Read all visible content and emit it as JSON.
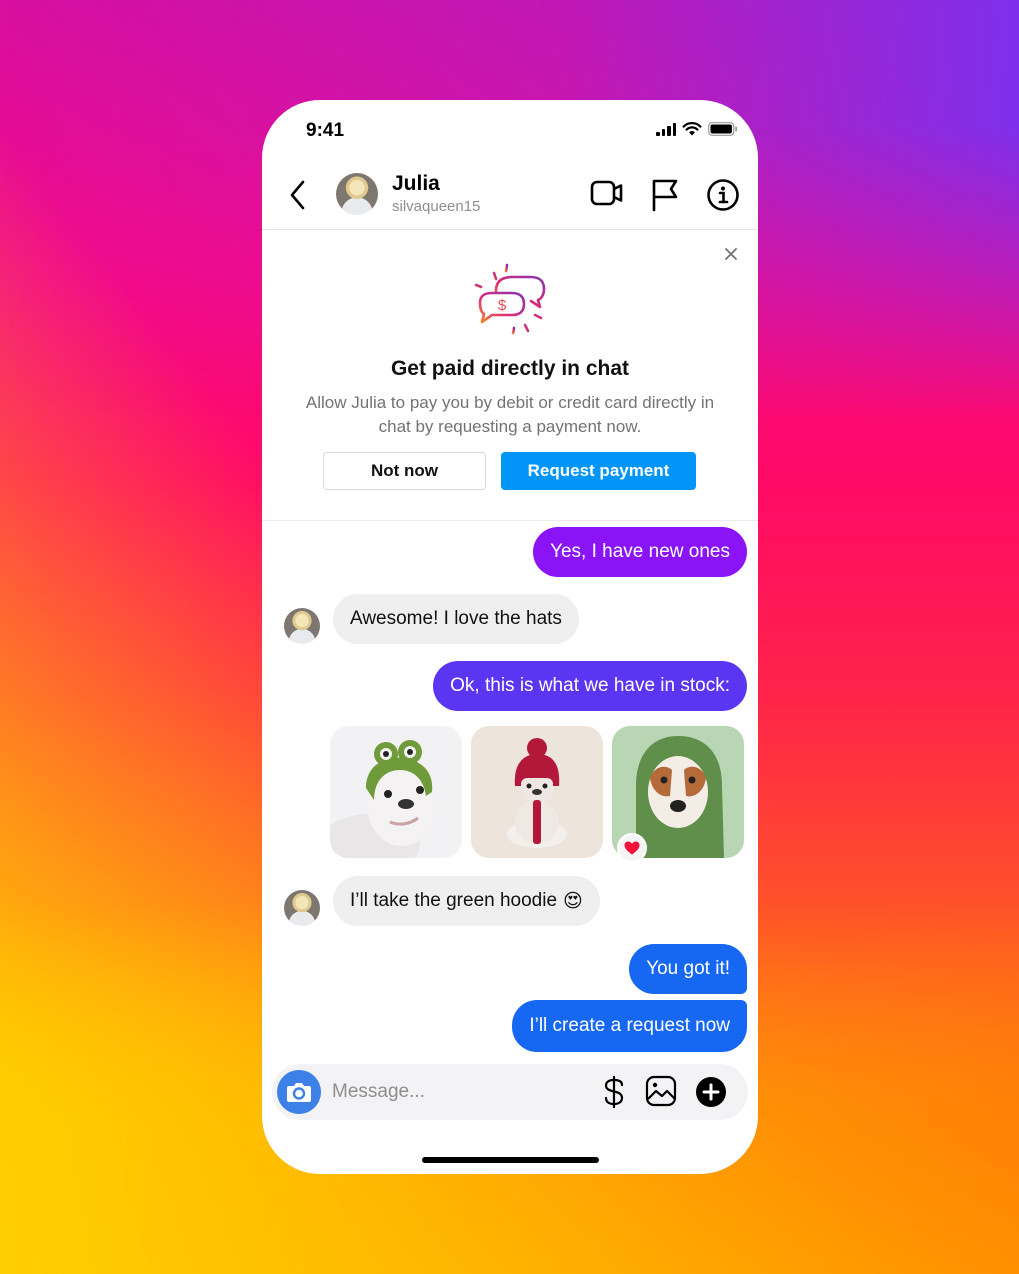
{
  "status_bar": {
    "time": "9:41",
    "icons": [
      "cellular-signal-icon",
      "wifi-icon",
      "battery-icon"
    ]
  },
  "header": {
    "back_icon": "chevron-left-icon",
    "contact_name": "Julia",
    "contact_handle": "silvaqueen15",
    "actions": [
      {
        "name": "video-call",
        "icon": "video-camera-icon"
      },
      {
        "name": "report",
        "icon": "flag-icon"
      },
      {
        "name": "info",
        "icon": "info-icon"
      }
    ]
  },
  "banner": {
    "icon": "payment-chat-bubbles-icon",
    "title": "Get paid directly in chat",
    "description": "Allow Julia to pay you by debit or credit card directly in chat by requesting a payment now.",
    "secondary_button": "Not now",
    "primary_button": "Request payment",
    "close_icon": "close-icon"
  },
  "messages": [
    {
      "direction": "outgoing",
      "text": "Yes, I have new ones",
      "color": "#8a14f6"
    },
    {
      "direction": "incoming",
      "text": "Awesome! I love the hats"
    },
    {
      "direction": "outgoing",
      "text": "Ok, this is what we have in stock:",
      "color": "#5b36f2"
    },
    {
      "direction": "outgoing",
      "type": "photos",
      "photos": [
        {
          "subject": "bulldog in green frog hat"
        },
        {
          "subject": "bulldog in red pom-pom beanie"
        },
        {
          "subject": "beagle in green knit hoodie",
          "reaction": "❤️"
        }
      ]
    },
    {
      "direction": "incoming",
      "text": "I’ll take the green hoodie",
      "emoji": "😍"
    },
    {
      "direction": "outgoing",
      "text": "You got it!",
      "color": "#1668f2"
    },
    {
      "direction": "outgoing",
      "text": "I’ll create a request now",
      "color": "#1668f2"
    }
  ],
  "composer": {
    "placeholder": "Message...",
    "value": "",
    "icons": [
      "camera-icon",
      "dollar-icon",
      "gallery-icon",
      "plus-circle-icon"
    ]
  },
  "colors": {
    "primary_button": "#0095f6",
    "camera_button": "#3d80e8",
    "incoming_bubble": "#efefef"
  }
}
